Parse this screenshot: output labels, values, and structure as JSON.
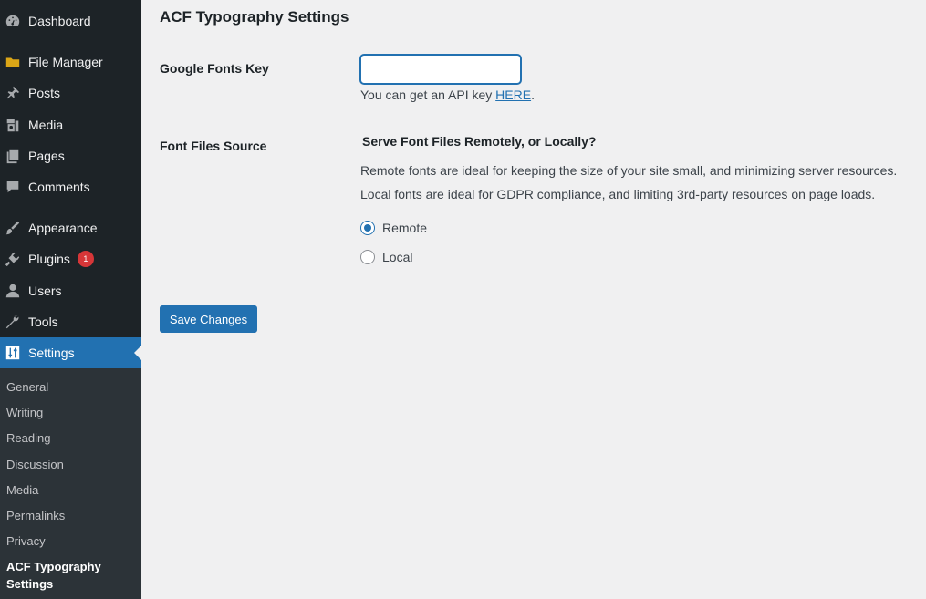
{
  "sidebar": {
    "menu": [
      {
        "label": "Dashboard",
        "icon": "dashboard-icon"
      },
      {
        "label": "File Manager",
        "icon": "folder-icon"
      },
      {
        "label": "Posts",
        "icon": "pushpin-icon"
      },
      {
        "label": "Media",
        "icon": "media-icon"
      },
      {
        "label": "Pages",
        "icon": "pages-icon"
      },
      {
        "label": "Comments",
        "icon": "comment-icon"
      },
      {
        "label": "Appearance",
        "icon": "brush-icon"
      },
      {
        "label": "Plugins",
        "icon": "plugin-icon",
        "badge": "1"
      },
      {
        "label": "Users",
        "icon": "user-icon"
      },
      {
        "label": "Tools",
        "icon": "wrench-icon"
      },
      {
        "label": "Settings",
        "icon": "settings-icon",
        "active": true
      }
    ],
    "submenu": [
      "General",
      "Writing",
      "Reading",
      "Discussion",
      "Media",
      "Permalinks",
      "Privacy",
      "ACF Typography Settings"
    ]
  },
  "main": {
    "title": "ACF Typography Settings",
    "google_fonts_key": {
      "label": "Google Fonts Key",
      "value": "",
      "help_prefix": "You can get an API key ",
      "help_link": "HERE",
      "help_suffix": "."
    },
    "font_source": {
      "label": "Font Files Source",
      "heading": "Serve Font Files Remotely, or Locally?",
      "desc1": "Remote fonts are ideal for keeping the size of your site small, and minimizing server resources.",
      "desc2": "Local fonts are ideal for GDPR compliance, and limiting 3rd-party resources on page loads.",
      "options": [
        {
          "label": "Remote",
          "checked": true
        },
        {
          "label": "Local",
          "checked": false
        }
      ]
    },
    "save_label": "Save Changes"
  },
  "colors": {
    "sidebar_bg": "#1d2327",
    "submenu_bg": "#2c3338",
    "accent": "#2271b1",
    "badge": "#d63638",
    "page_bg": "#f0f0f1"
  }
}
